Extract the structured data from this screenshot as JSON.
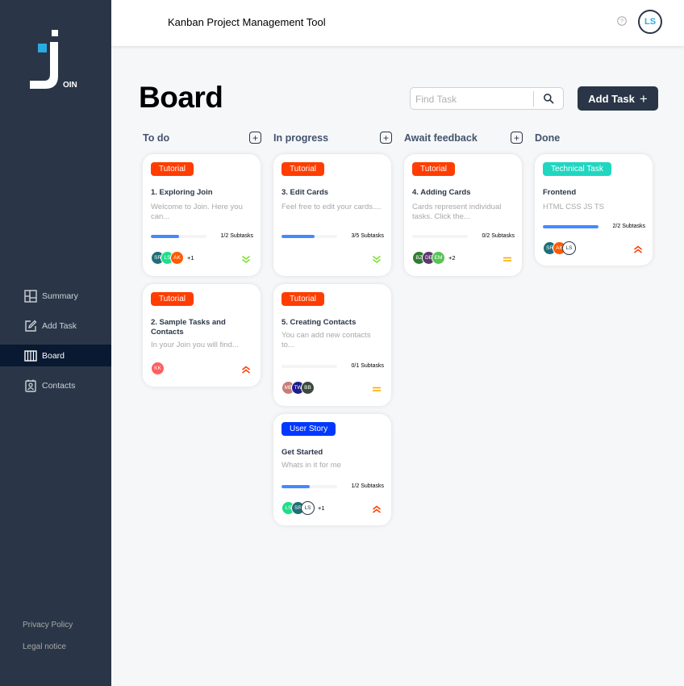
{
  "app": {
    "header_title": "Kanban Project Management Tool",
    "user_initials": "LS",
    "logo_letters": "OIN"
  },
  "sidebar": {
    "items": [
      {
        "label": "Summary",
        "icon": "summary-icon"
      },
      {
        "label": "Add Task",
        "icon": "add-task-icon"
      },
      {
        "label": "Board",
        "icon": "board-icon",
        "active": true
      },
      {
        "label": "Contacts",
        "icon": "contacts-icon"
      }
    ],
    "footer": [
      "Privacy Policy",
      "Legal notice"
    ]
  },
  "board": {
    "title": "Board",
    "search_placeholder": "Find Task",
    "add_task_label": "Add Task",
    "add_symbol": "+"
  },
  "columns": [
    {
      "title": "To do"
    },
    {
      "title": "In progress"
    },
    {
      "title": "Await feedback"
    },
    {
      "title": "Done"
    }
  ],
  "colors": {
    "sidebar": "#2a3647",
    "active_nav": "#091931",
    "tutorial": "#ff3d00",
    "user_story": "#0038ff",
    "technical_task": "#1fd7c1",
    "progress": "#4589ff",
    "prio_urgent": "#ff3d00",
    "prio_medium": "#ffa800",
    "prio_low": "#7ae229"
  },
  "cards": [
    {
      "id": "c1",
      "category": "Tutorial",
      "title": "1. Exploring Join",
      "description": "Welcome to Join. Here you can...",
      "progress": 0.5,
      "subtasks": "1/2 Subtasks",
      "assignees": [
        "SR",
        "LS",
        "AK"
      ],
      "more": "+1",
      "priority": "low"
    },
    {
      "id": "c2",
      "category": "Tutorial",
      "title": "2. Sample Tasks and Contacts",
      "description": "In your Join you will find...",
      "assignees": [
        "KK"
      ],
      "priority": "urgent"
    },
    {
      "id": "c3",
      "category": "Tutorial",
      "title": "3. Edit Cards",
      "description": "Feel free to edit your cards....",
      "progress": 0.6,
      "subtasks": "3/5 Subtasks",
      "assignees": [],
      "priority": "low"
    },
    {
      "id": "c4",
      "category": "Tutorial",
      "title": "5. Creating Contacts",
      "description": "You can add new contacts to...",
      "progress": 0,
      "subtasks": "0/1 Subtasks",
      "assignees": [
        "MB",
        "TW",
        "BB"
      ],
      "priority": "medium"
    },
    {
      "id": "c5",
      "category": "User Story",
      "title": "Get Started",
      "description": "Whats in it for me",
      "progress": 0.5,
      "subtasks": "1/2 Subtasks",
      "assignees": [
        "LS",
        "SR",
        "LS"
      ],
      "more": "+1",
      "priority": "urgent"
    },
    {
      "id": "c6",
      "category": "Tutorial",
      "title": "4. Adding Cards",
      "description": "Cards represent individual tasks. Click the...",
      "progress": 0,
      "subtasks": "0/2 Subtasks",
      "assignees": [
        "BZ",
        "DE",
        "EM"
      ],
      "more": "+2",
      "priority": "medium"
    },
    {
      "id": "c7",
      "category": "Technical Task",
      "title": "Frontend",
      "description": "HTML CSS JS TS",
      "progress": 1,
      "subtasks": "2/2 Subtasks",
      "assignees": [
        "SR",
        "AK",
        "LS"
      ],
      "priority": "urgent"
    }
  ]
}
